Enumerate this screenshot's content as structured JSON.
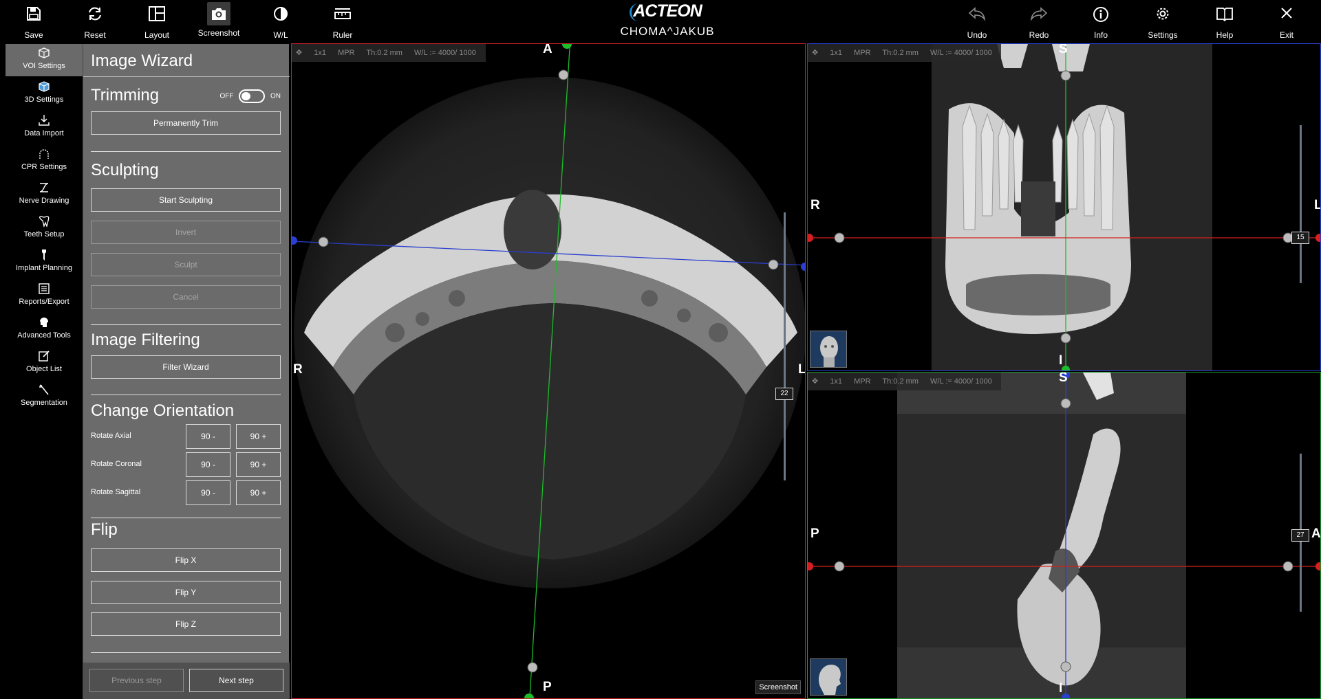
{
  "toolbar": {
    "left": [
      {
        "label": "Save",
        "icon": "save-icon"
      },
      {
        "label": "Reset",
        "icon": "reset-icon"
      },
      {
        "label": "Layout",
        "icon": "layout-icon"
      },
      {
        "label": "Screenshot",
        "icon": "camera-icon"
      },
      {
        "label": "W/L",
        "icon": "window-level-icon"
      },
      {
        "label": "Ruler",
        "icon": "ruler-icon"
      }
    ],
    "right": [
      {
        "label": "Undo",
        "icon": "undo-icon"
      },
      {
        "label": "Redo",
        "icon": "redo-icon"
      },
      {
        "label": "Info",
        "icon": "info-icon"
      },
      {
        "label": "Settings",
        "icon": "gear-icon"
      },
      {
        "label": "Help",
        "icon": "book-icon"
      },
      {
        "label": "Exit",
        "icon": "close-icon"
      }
    ]
  },
  "brand": {
    "logo": "ACTEON",
    "patient": "CHOMA^JAKUB"
  },
  "nav": [
    {
      "label": "VOI Settings",
      "icon": "cube-icon",
      "active": true
    },
    {
      "label": "3D Settings",
      "icon": "3d-cube-icon"
    },
    {
      "label": "Data Import",
      "icon": "download-icon"
    },
    {
      "label": "CPR Settings",
      "icon": "arch-icon"
    },
    {
      "label": "Nerve Drawing",
      "icon": "nerve-icon"
    },
    {
      "label": "Teeth Setup",
      "icon": "tooth-icon"
    },
    {
      "label": "Implant Planning",
      "icon": "implant-icon"
    },
    {
      "label": "Reports/Export",
      "icon": "report-icon"
    },
    {
      "label": "Advanced Tools",
      "icon": "head-gear-icon"
    },
    {
      "label": "Object List",
      "icon": "edit-list-icon"
    },
    {
      "label": "Segmentation",
      "icon": "wand-icon"
    }
  ],
  "wizard": {
    "title": "Image Wizard",
    "trimming": {
      "title": "Trimming",
      "off": "OFF",
      "on": "ON",
      "permanent_trim": "Permanently Trim"
    },
    "sculpting": {
      "title": "Sculpting",
      "start": "Start Sculpting",
      "invert": "Invert",
      "sculpt": "Sculpt",
      "cancel": "Cancel"
    },
    "filtering": {
      "title": "Image Filtering",
      "filter_wizard": "Filter Wizard"
    },
    "orientation": {
      "title": "Change Orientation",
      "rows": [
        {
          "label": "Rotate Axial",
          "minus": "90 -",
          "plus": "90 +"
        },
        {
          "label": "Rotate Coronal",
          "minus": "90 -",
          "plus": "90 +"
        },
        {
          "label": "Rotate Sagittal",
          "minus": "90 -",
          "plus": "90 +"
        }
      ]
    },
    "flip": {
      "title": "Flip",
      "x": "Flip X",
      "y": "Flip Y",
      "z": "Flip Z"
    },
    "footer": {
      "previous": "Previous step",
      "next": "Next step"
    }
  },
  "viewports": {
    "axial": {
      "layout": "1x1",
      "mode": "MPR",
      "thickness": "Th:0.2 mm",
      "wl": "W/L := 4000/ 1000",
      "top": "A",
      "bottom": "P",
      "left": "R",
      "right": "L",
      "slice": "22",
      "screenshot": "Screenshot",
      "border_color": "#c8202a"
    },
    "coronal": {
      "layout": "1x1",
      "mode": "MPR",
      "thickness": "Th:0.2 mm",
      "wl": "W/L := 4000/ 1000",
      "top": "S",
      "bottom": "I",
      "left": "R",
      "right": "L",
      "slice": "15",
      "border_color": "#2a3fd0"
    },
    "sagittal": {
      "layout": "1x1",
      "mode": "MPR",
      "thickness": "Th:0.2 mm",
      "wl": "W/L := 4000/ 1000",
      "top": "S",
      "bottom": "I",
      "left": "P",
      "right": "A",
      "slice": "27",
      "border_color": "#1d9a2a"
    }
  },
  "colors": {
    "axial_line": "#2a3fd0",
    "coronal_line": "#1ebd2c",
    "sagittal_line": "#d81e1e"
  }
}
